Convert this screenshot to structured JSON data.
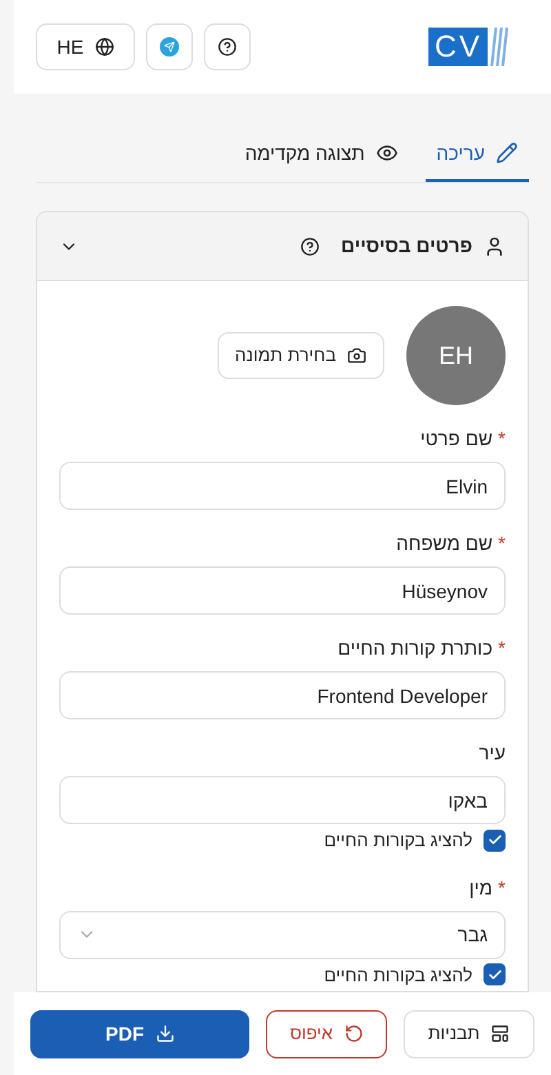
{
  "header": {
    "logo": "CV",
    "language": "HE"
  },
  "tabs": [
    {
      "label": "עריכה",
      "selected": true
    },
    {
      "label": "תצוגה מקדימה",
      "selected": false
    }
  ],
  "section": {
    "title": "פרטים בסיסיים",
    "expanded": true,
    "avatar_initials": "EH",
    "photo_button": "בחירת תמונה",
    "fields": [
      {
        "kind": "text",
        "label": "שם פרטי",
        "required_mark": "*",
        "value": "Elvin"
      },
      {
        "kind": "text",
        "label": "שם משפחה",
        "required_mark": "*",
        "value": "Hüseynov"
      },
      {
        "kind": "text",
        "label": "כותרת קורות החיים",
        "required_mark": "*",
        "value": "Frontend Developer"
      },
      {
        "kind": "text",
        "label": "עיר",
        "value": "באקו",
        "show_in_cv": {
          "label": "להציג בקורות החיים",
          "checked": true
        }
      },
      {
        "kind": "select",
        "label": "מין",
        "required_mark": "*",
        "value": "גבר",
        "show_in_cv": {
          "label": "להציג בקורות החיים",
          "checked": true
        }
      }
    ]
  },
  "footer": {
    "templates": "תבניות",
    "reset": "איפוס",
    "pdf": "PDF"
  }
}
